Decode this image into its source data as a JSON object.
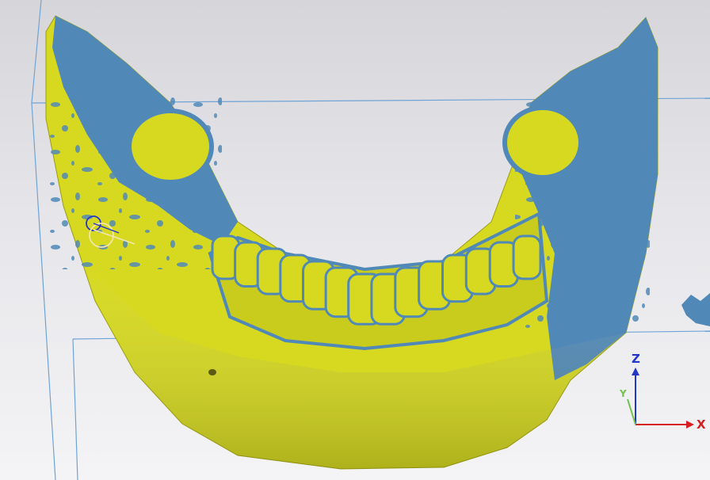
{
  "viewport": {
    "background_top": "#d6d6da",
    "background_bottom": "#f4f4f6",
    "bounding_box_color": "#6fa3d6"
  },
  "model": {
    "primary_color": "#d6d91f",
    "overlay_color": "#5089b7",
    "tooth_count": 14
  },
  "axes": {
    "z_label": "Z",
    "x_label": "X",
    "y_label": "Y",
    "z_color": "#2436c8",
    "x_color": "#d62020",
    "y_color": "#6fc24a"
  },
  "gizmo": {
    "icon": "rotation-handle-icon",
    "ring_color": "#2436c8",
    "handle_color": "#f1e6b0"
  }
}
